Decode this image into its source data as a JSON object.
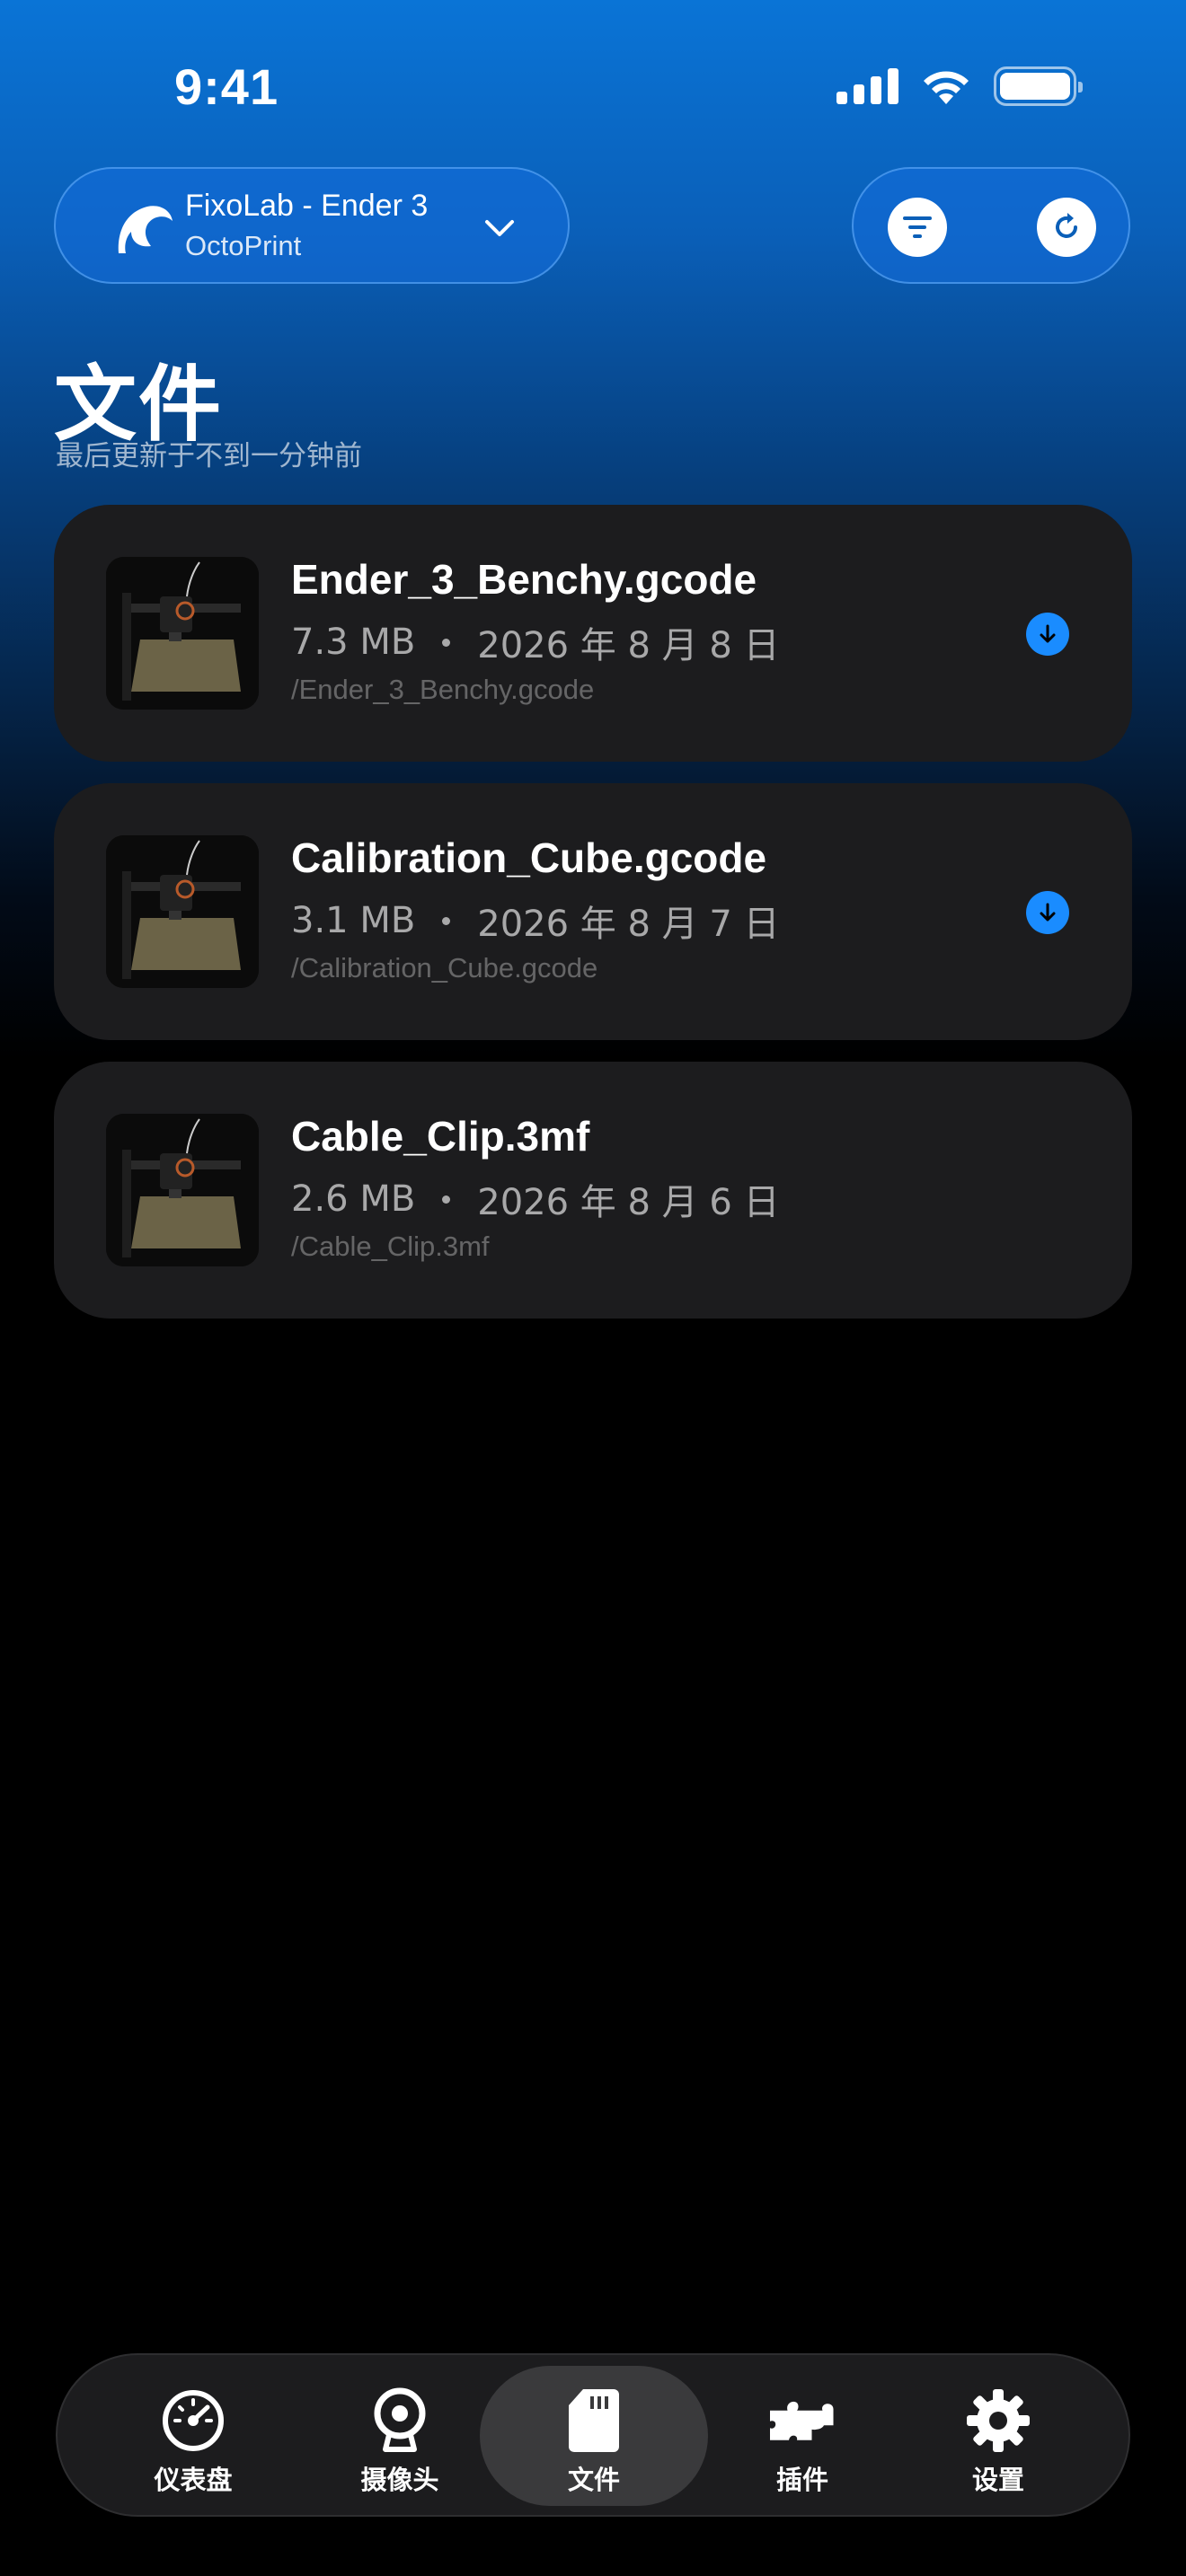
{
  "status_bar": {
    "time": "9:41"
  },
  "printer": {
    "name": "FixoLab - Ender 3",
    "software": "OctoPrint"
  },
  "page": {
    "title": "文件",
    "subtitle": "最后更新于不到一分钟前"
  },
  "files": [
    {
      "name": "Ender_3_Benchy.gcode",
      "size": "7.3 MB",
      "date": "2026 年 8 月 8 日",
      "path": "/Ender_3_Benchy.gcode",
      "downloadable": true
    },
    {
      "name": "Calibration_Cube.gcode",
      "size": "3.1 MB",
      "date": "2026 年 8 月 7 日",
      "path": "/Calibration_Cube.gcode",
      "downloadable": true
    },
    {
      "name": "Cable_Clip.3mf",
      "size": "2.6 MB",
      "date": "2026 年 8 月 6 日",
      "path": "/Cable_Clip.3mf",
      "downloadable": false
    }
  ],
  "tabs": [
    {
      "label": "仪表盘",
      "icon": "gauge-icon",
      "active": false
    },
    {
      "label": "摄像头",
      "icon": "webcam-icon",
      "active": false
    },
    {
      "label": "文件",
      "icon": "sd-card-icon",
      "active": true
    },
    {
      "label": "插件",
      "icon": "puzzle-icon",
      "active": false
    },
    {
      "label": "设置",
      "icon": "gear-icon",
      "active": false
    }
  ],
  "colors": {
    "accent": "#1a8cff",
    "card": "#1c1c1e",
    "tab_active": "#3a3a3c"
  }
}
